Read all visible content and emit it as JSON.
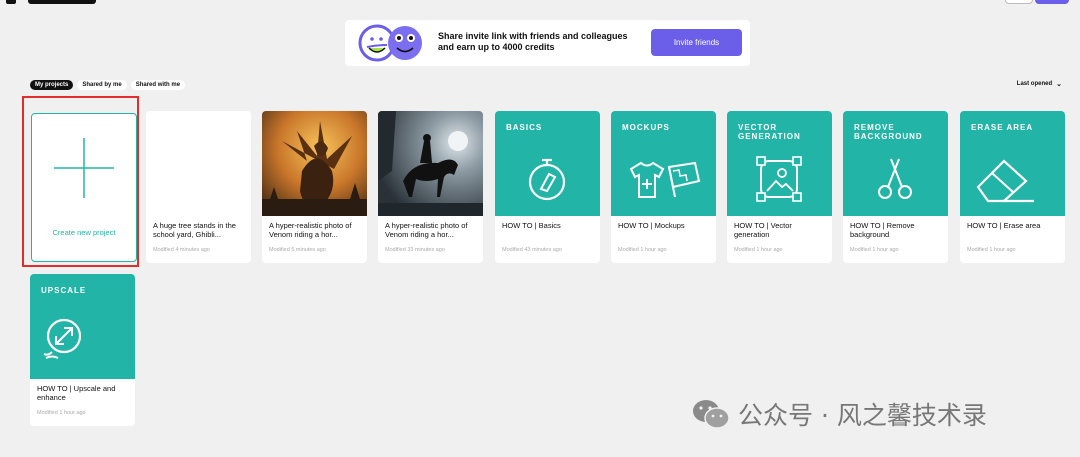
{
  "invite": {
    "text": "Share invite link with friends and colleagues and earn up to 4000 credits",
    "button": "Invite friends"
  },
  "tabs": [
    {
      "label": "My projects",
      "active": true
    },
    {
      "label": "Shared by me",
      "active": false
    },
    {
      "label": "Shared with me",
      "active": false
    }
  ],
  "sort": {
    "label": "Last opened",
    "icon": "chevron-down-icon"
  },
  "new_project": {
    "label": "Create new project"
  },
  "projects": [
    {
      "title": "A huge tree stands in the school yard, Ghibli...",
      "modified": "Modified 4 minutes ago",
      "thumb": "blank"
    },
    {
      "title": "A hyper-realistic photo of Venom riding a hor...",
      "modified": "Modified 5 minutes ago",
      "thumb": "dragon-image"
    },
    {
      "title": "A hyper-realistic photo of Venom riding a hor...",
      "modified": "Modified 33 minutes ago",
      "thumb": "rider-image"
    },
    {
      "label": "BASICS",
      "title": "HOW TO | Basics",
      "modified": "Modified 43 minutes ago",
      "thumb": "stopwatch-icon"
    },
    {
      "label": "MOCKUPS",
      "title": "HOW TO | Mockups",
      "modified": "Modified 1 hour ago",
      "thumb": "tshirt-flag-icon"
    },
    {
      "label": "VECTOR GENERATION",
      "title": "HOW TO | Vector generation",
      "modified": "Modified 1 hour ago",
      "thumb": "vector-image-icon"
    },
    {
      "label": "REMOVE BACKGROUND",
      "title": "HOW TO | Remove background",
      "modified": "Modified 1 hour ago",
      "thumb": "scissors-icon"
    },
    {
      "label": "ERASE AREA",
      "title": "HOW TO | Erase area",
      "modified": "Modified 1 hour ago",
      "thumb": "eraser-icon"
    },
    {
      "label": "UPSCALE",
      "title": "HOW TO | Upscale and enhance",
      "modified": "Modified 1 hour ago",
      "thumb": "upscale-icon"
    }
  ],
  "watermark": "公众号 · 风之馨技术录",
  "colors": {
    "accent": "#6b5ee8",
    "teal": "#22b5a7",
    "highlight": "#e02d2d"
  }
}
